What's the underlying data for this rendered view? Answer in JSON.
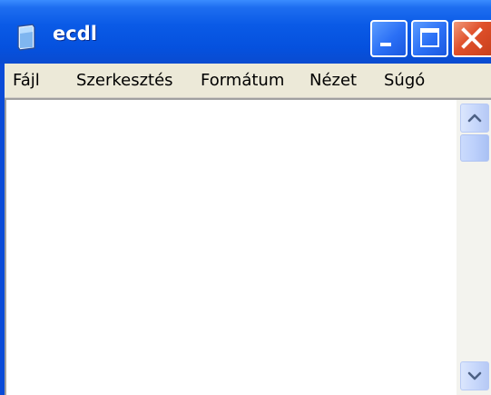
{
  "window": {
    "title": "ecdl",
    "icon": "notepad-icon"
  },
  "title_buttons": {
    "minimize_icon": "minimize-icon",
    "maximize_icon": "maximize-icon",
    "close_icon": "close-icon"
  },
  "menu": {
    "items": [
      {
        "label": "Fájl"
      },
      {
        "label": "Szerkesztés"
      },
      {
        "label": "Formátum"
      },
      {
        "label": "Nézet"
      },
      {
        "label": "Súgó"
      }
    ]
  },
  "editor": {
    "text": ""
  },
  "colors": {
    "titlebar": "#0551de",
    "menubar": "#ece9d8",
    "close_button": "#e0502a"
  }
}
